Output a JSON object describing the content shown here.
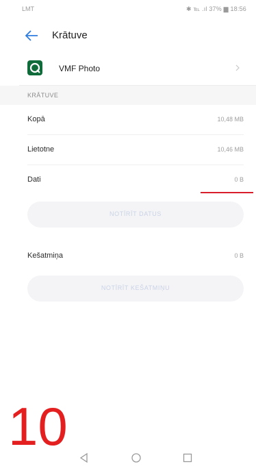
{
  "status_bar": {
    "carrier": "LMT",
    "indicators": "✱ ℡ .ıl 37% ▆ 18:56"
  },
  "app_bar": {
    "title": "Krātuve",
    "back_icon": "arrow-left-icon"
  },
  "app_row": {
    "name": "VMF Photo",
    "icon": "vmf-photo-app-icon",
    "icon_color": "#0f6b3a"
  },
  "section": {
    "header": "KRĀTUVE"
  },
  "storage": {
    "rows": [
      {
        "label": "Kopā",
        "value": "10,48 MB"
      },
      {
        "label": "Lietotne",
        "value": "10,46 MB"
      },
      {
        "label": "Dati",
        "value": "0 B"
      }
    ],
    "clear_data_button": "NOTĪRĪT DATUS",
    "cache_label": "Kešatmiņa",
    "cache_value": "0 B",
    "clear_cache_button": "NOTĪRĪT KEŠATMIŅU"
  },
  "annotation": {
    "number": "10",
    "color": "#e41f1f",
    "underline_color": "#d81e2a"
  },
  "nav_bar": {
    "back_icon": "triangle-back-icon",
    "home_icon": "circle-home-icon",
    "recents_icon": "square-recents-icon"
  }
}
